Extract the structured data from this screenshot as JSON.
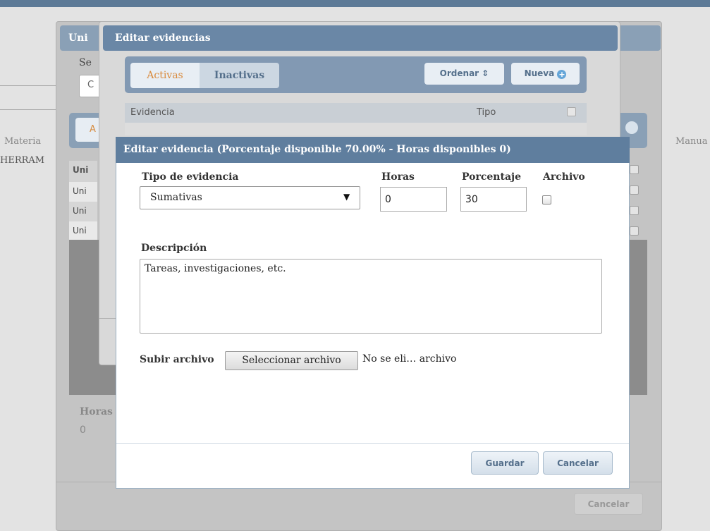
{
  "background": {
    "outer_window": {
      "title": "Uni",
      "select_label": "Se",
      "select_value": "C",
      "tab_partial": "A",
      "col_materia": "Materia",
      "col_manual": "Manua",
      "row_herram": "HERRAM",
      "table_header": "Uni",
      "rows": [
        "Uni",
        "Uni",
        "Uni"
      ],
      "horas_label": "Horas",
      "horas_value": "0",
      "cancel_label": "Cancelar"
    },
    "evidencias_modal": {
      "title": "Editar evidencias",
      "tab_active": "Activas",
      "tab_inactive": "Inactivas",
      "ordenar_label": "Ordenar ⇕",
      "nueva_label": "Nueva",
      "col_evidencia": "Evidencia",
      "col_tipo": "Tipo"
    }
  },
  "dialog": {
    "title": "Editar evidencia (Porcentaje disponible 70.00% - Horas disponibles 0)",
    "tipo_label": "Tipo de evidencia",
    "tipo_value": "Sumativas",
    "horas_label": "Horas",
    "horas_value": "0",
    "porcentaje_label": "Porcentaje",
    "porcentaje_value": "30",
    "archivo_label": "Archivo",
    "archivo_checked": false,
    "descripcion_label": "Descripción",
    "descripcion_value": "Tareas, investigaciones, etc.",
    "subir_label": "Subir archivo",
    "select_file_button": "Seleccionar archivo",
    "file_name": "No se eli… archivo",
    "guardar_label": "Guardar",
    "cancelar_label": "Cancelar"
  }
}
